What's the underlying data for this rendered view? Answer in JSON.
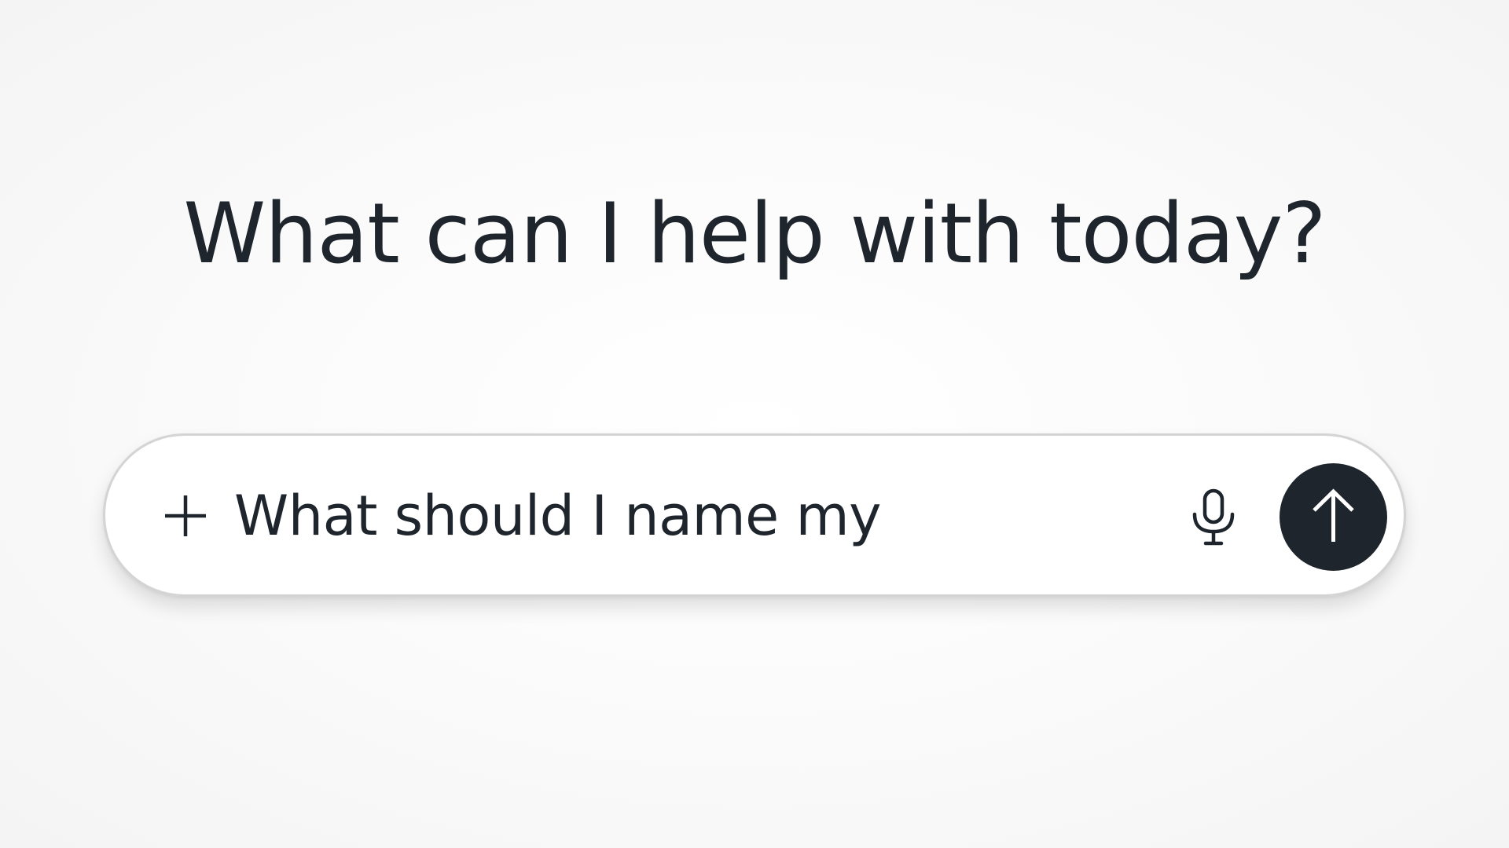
{
  "main": {
    "heading": "What can I help with today?"
  },
  "composer": {
    "input_value": "What should I name my",
    "icons": {
      "attach": "plus-icon",
      "voice": "microphone-icon",
      "send": "arrow-up-icon"
    }
  },
  "colors": {
    "text": "#1f252c",
    "send_button": "#1f252c",
    "composer_border": "#d4d4d4",
    "composer_bg": "#ffffff"
  }
}
